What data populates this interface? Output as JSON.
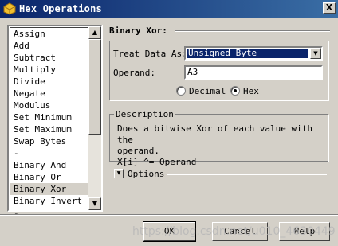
{
  "window": {
    "title": "Hex Operations",
    "close_label": "X"
  },
  "list": {
    "items": [
      "Assign",
      "Add",
      "Subtract",
      "Multiply",
      "Divide",
      "Negate",
      "Modulus",
      "Set Minimum",
      "Set Maximum",
      "Swap Bytes",
      "-",
      "Binary And",
      "Binary Or",
      "Binary Xor",
      "Binary Invert",
      "-"
    ],
    "selected": "Binary Xor",
    "scroll_up": "▲",
    "scroll_down": "▼"
  },
  "panel": {
    "heading": "Binary Xor:",
    "treat_data_label": "Treat Data As:",
    "treat_data_value": "Unsigned Byte",
    "operand_label": "Operand:",
    "operand_value": "A3",
    "radio_decimal": "Decimal",
    "radio_hex": "Hex",
    "selected_radix": "Hex",
    "combo_arrow": "▼"
  },
  "description": {
    "legend": "Description",
    "line1": "Does a bitwise Xor of each value with the",
    "line2": "operand.",
    "line3": "X[i] ^= Operand"
  },
  "options": {
    "label": "Options",
    "toggle": "▼"
  },
  "buttons": {
    "ok": "OK",
    "cancel": "Cancel",
    "help": "Help"
  },
  "watermark": "https://blog.csdn.net/u010_4630449",
  "colors": {
    "title_bar": "#0a246a",
    "selection": "#0a246a",
    "face": "#d4d0c8"
  }
}
